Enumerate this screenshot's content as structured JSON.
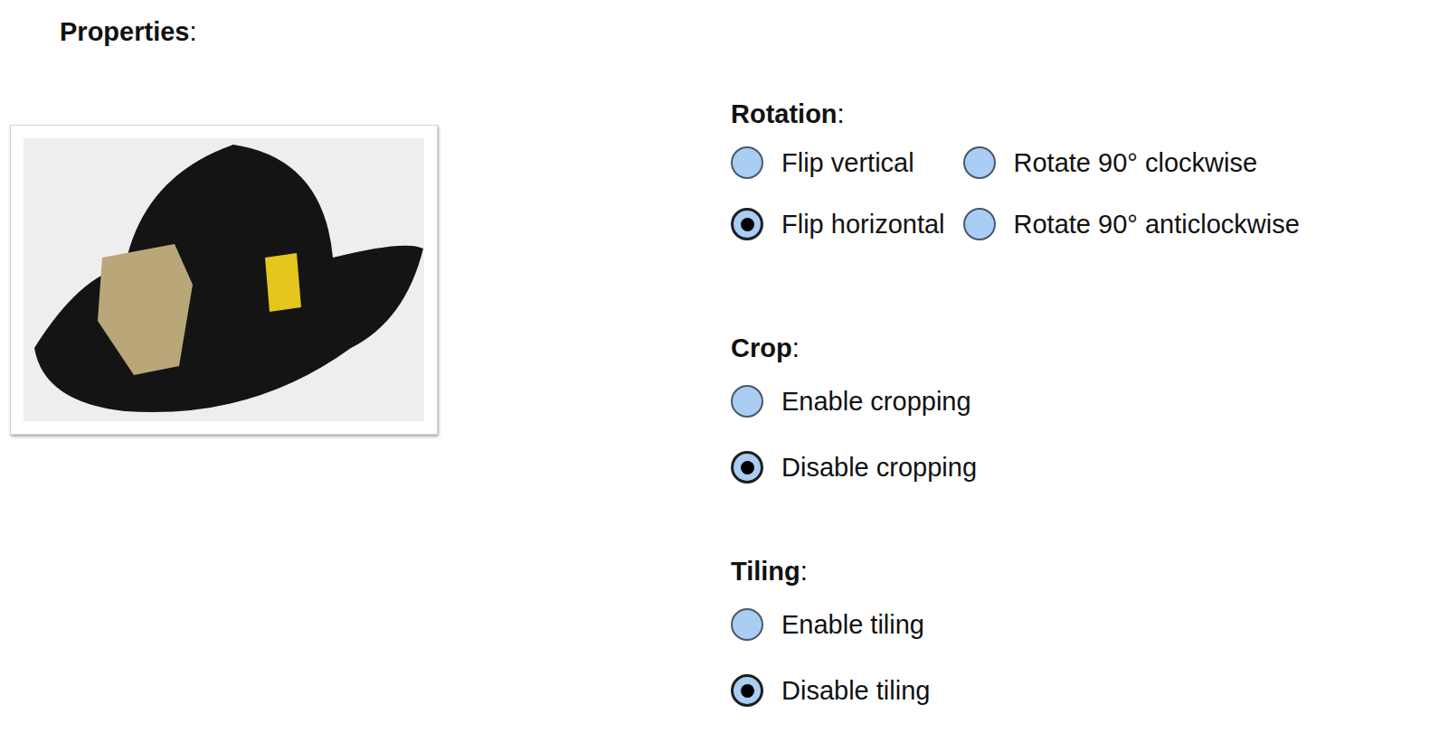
{
  "title": {
    "label": "Properties",
    "punct": ":"
  },
  "groups": [
    {
      "label": "Rotation",
      "punct": ":",
      "options": [
        {
          "label": "Flip vertical",
          "selected": false
        },
        {
          "label": "Flip horizontal",
          "selected": true
        },
        {
          "label": "Rotate 90° clockwise",
          "selected": false
        },
        {
          "label": "Rotate 90° anticlockwise",
          "selected": false
        }
      ]
    },
    {
      "label": "Crop",
      "punct": ":",
      "options": [
        {
          "label": "Enable cropping",
          "selected": false
        },
        {
          "label": "Disable cropping",
          "selected": true
        }
      ]
    },
    {
      "label": "Tiling",
      "punct": ":",
      "options": [
        {
          "label": "Enable tiling",
          "selected": false
        },
        {
          "label": "Disable tiling",
          "selected": true
        }
      ]
    }
  ]
}
